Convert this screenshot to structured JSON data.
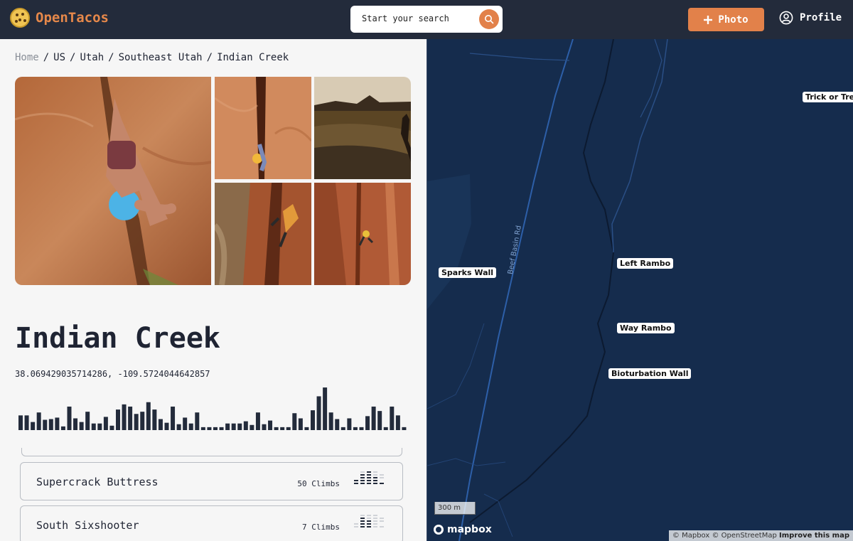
{
  "header": {
    "app_name": "OpenTacos",
    "search_placeholder": "Start your search",
    "photo_button": "Photo",
    "profile_label": "Profile"
  },
  "breadcrumb": [
    "Home",
    "US",
    "Utah",
    "Southeast Utah",
    "Indian Creek"
  ],
  "area": {
    "title": "Indian Creek",
    "coordinates": "38.069429035714286, -109.5724044642857"
  },
  "histogram": {
    "bar_color": "#232b3b",
    "values": [
      20,
      20,
      11,
      24,
      14,
      15,
      17,
      5,
      32,
      16,
      11,
      25,
      9,
      9,
      18,
      6,
      28,
      35,
      32,
      22,
      25,
      38,
      28,
      15,
      10,
      32,
      8,
      17,
      9,
      24,
      4,
      4,
      4,
      4,
      9,
      9,
      9,
      12,
      7,
      24,
      8,
      13,
      4,
      4,
      4,
      23,
      16,
      4,
      27,
      46,
      58,
      24,
      15,
      4,
      16,
      4,
      4,
      19,
      32,
      26,
      4,
      32,
      20,
      4
    ]
  },
  "crags": [
    {
      "name": "Supercrack Buttress",
      "count_label": "50 Climbs"
    },
    {
      "name": "South Sixshooter",
      "count_label": "7 Climbs"
    }
  ],
  "map": {
    "labels": [
      "Trick or Treat",
      "Sparks Wall",
      "Left Rambo",
      "Way Rambo",
      "Bioturbation Wall"
    ],
    "road_label": "Beef Basin Rd",
    "scale": "300 m",
    "logo": "mapbox",
    "attribution_text": "© Mapbox © OpenStreetMap",
    "attribution_link": "Improve this map"
  },
  "colors": {
    "accent": "#e2814a",
    "header_bg": "#232b3b",
    "map_bg": "#152c4d"
  }
}
